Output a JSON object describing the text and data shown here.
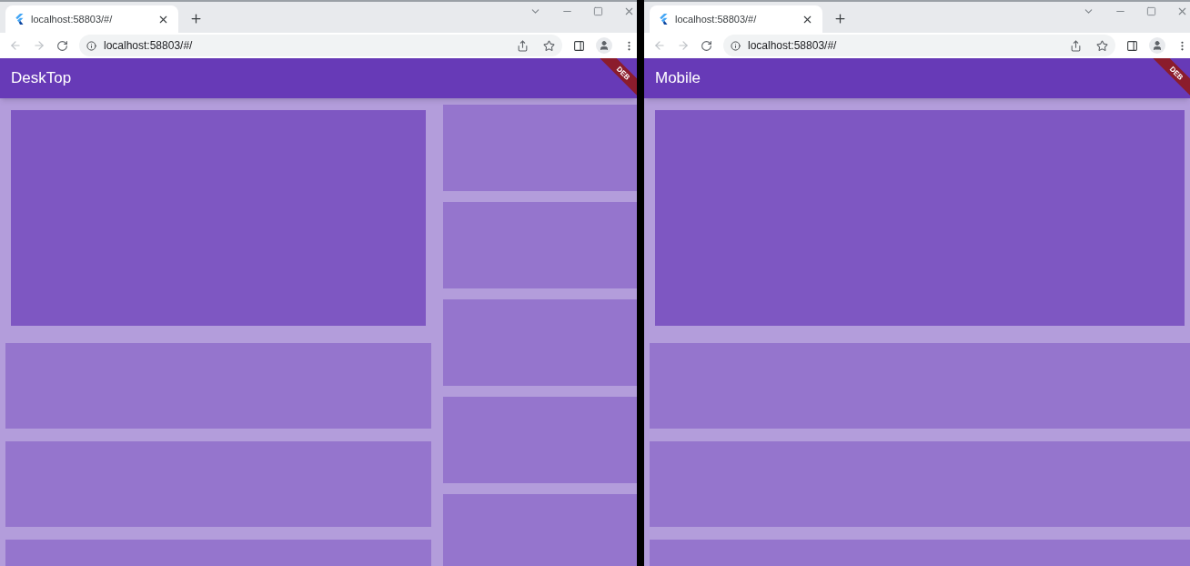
{
  "windows": [
    {
      "kind": "desktop",
      "tab": {
        "title": "localhost:58803/#/"
      },
      "address": "localhost:58803/#/",
      "app_bar": {
        "title": "DeskTop"
      },
      "banner": "DEB"
    },
    {
      "kind": "mobile",
      "tab": {
        "title": "localhost:58803/#/"
      },
      "address": "localhost:58803/#/",
      "app_bar": {
        "title": "Mobile"
      },
      "banner": "DEB"
    }
  ]
}
